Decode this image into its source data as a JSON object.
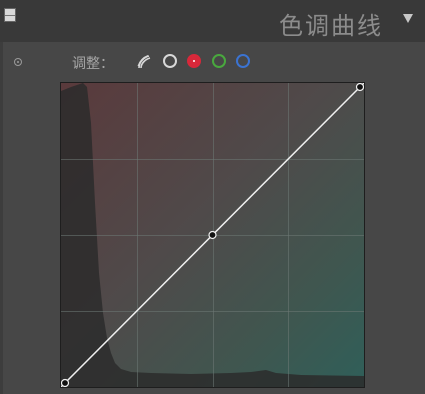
{
  "header": {
    "title": "色调曲线",
    "collapse_icon": "triangle-down-icon"
  },
  "panel": {
    "adjust_label": "调整：",
    "modes": [
      {
        "name": "point-curve",
        "icon": "point-curve-icon",
        "color": "#d8d8d8"
      },
      {
        "name": "rgb",
        "icon": "circle-icon",
        "color": "#d8d8d8"
      },
      {
        "name": "red",
        "icon": "circle-icon",
        "color": "#d8283a",
        "selected": true
      },
      {
        "name": "green",
        "icon": "circle-icon",
        "color": "#49a83e"
      },
      {
        "name": "blue",
        "icon": "circle-icon",
        "color": "#3b73d1"
      }
    ],
    "curve": {
      "points": [
        [
          0,
          0
        ],
        [
          0.5,
          0.5
        ],
        [
          1,
          1
        ]
      ],
      "grid_divisions": 4
    }
  }
}
